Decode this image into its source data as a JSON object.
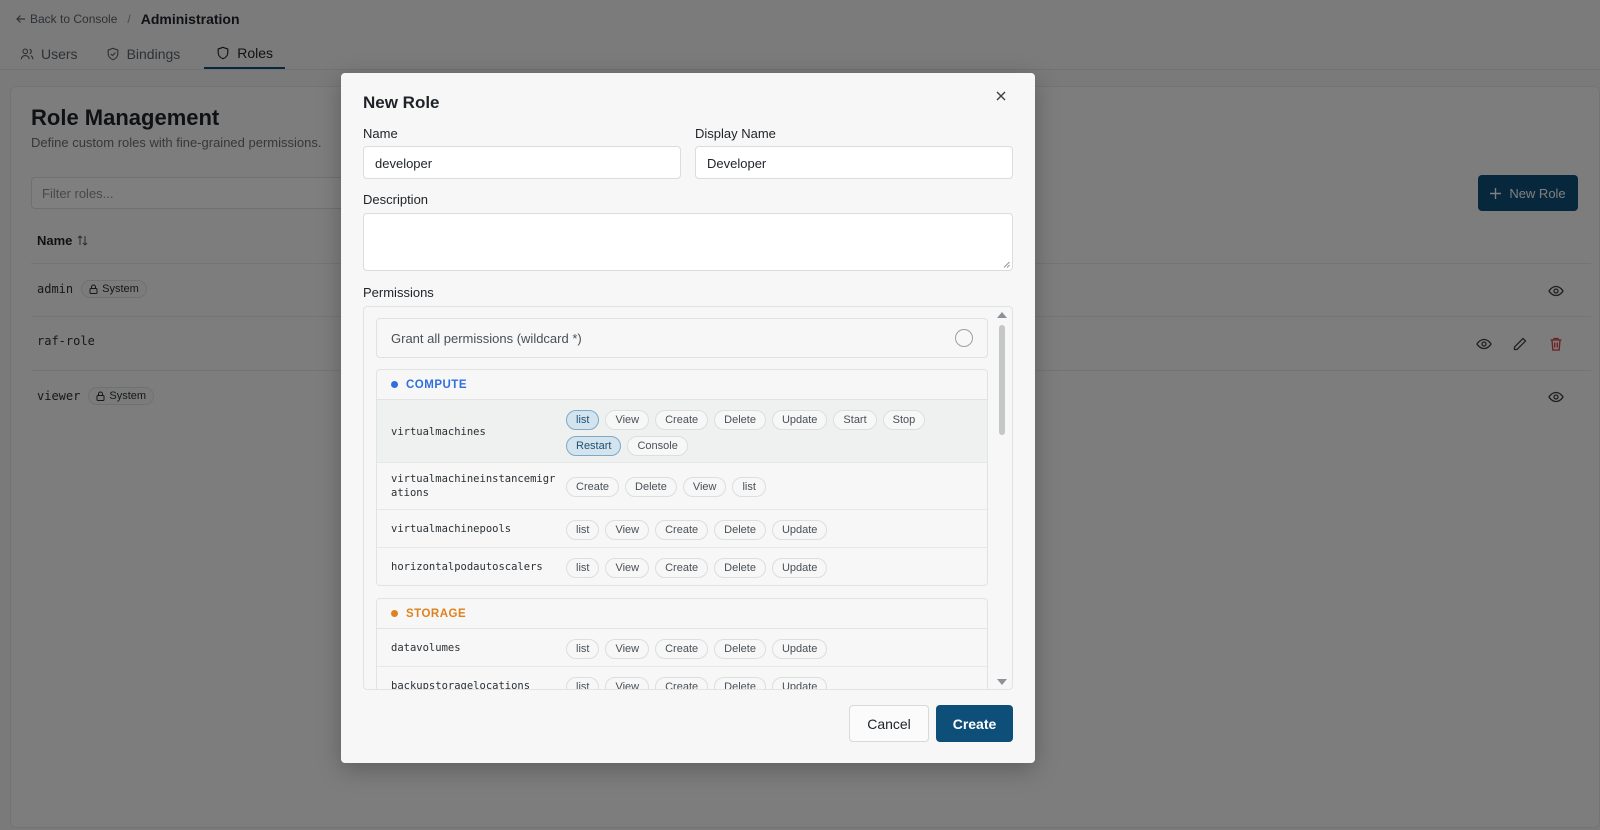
{
  "breadcrumb": {
    "back_label": "Back to Console",
    "separator": "/",
    "current": "Administration"
  },
  "tabs": [
    {
      "label": "Users",
      "icon": "users-icon"
    },
    {
      "label": "Bindings",
      "icon": "shield-icon"
    },
    {
      "label": "Roles",
      "icon": "shield-icon",
      "active": true
    }
  ],
  "page": {
    "title": "Role Management",
    "subtitle": "Define custom roles with fine-grained permissions.",
    "filter_placeholder": "Filter roles...",
    "new_role_label": "New Role",
    "column_name": "Name"
  },
  "roles": [
    {
      "name": "admin",
      "badge": "System"
    },
    {
      "name": "raf-role",
      "badge": ""
    },
    {
      "name": "viewer",
      "badge": "System"
    }
  ],
  "modal": {
    "title": "New Role",
    "name_label": "Name",
    "name_value": "developer",
    "display_name_label": "Display Name",
    "display_name_value": "Developer",
    "description_label": "Description",
    "description_value": "",
    "permissions_label": "Permissions",
    "wildcard_label": "Grant all permissions (wildcard *)",
    "cancel_label": "Cancel",
    "create_label": "Create"
  },
  "permission_groups": [
    {
      "name": "COMPUTE",
      "color": "#2f6fe0",
      "resources": [
        {
          "name": "virtualmachines",
          "verbs": [
            {
              "v": "list",
              "on": true
            },
            {
              "v": "View"
            },
            {
              "v": "Create"
            },
            {
              "v": "Delete"
            },
            {
              "v": "Update"
            },
            {
              "v": "Start"
            },
            {
              "v": "Stop"
            },
            {
              "v": "Restart",
              "on": true
            },
            {
              "v": "Console"
            }
          ]
        },
        {
          "name": "virtualmachineinstancemigr\nations",
          "verbs": [
            {
              "v": "Create"
            },
            {
              "v": "Delete"
            },
            {
              "v": "View"
            },
            {
              "v": "list"
            }
          ]
        },
        {
          "name": "virtualmachinepools",
          "verbs": [
            {
              "v": "list"
            },
            {
              "v": "View"
            },
            {
              "v": "Create"
            },
            {
              "v": "Delete"
            },
            {
              "v": "Update"
            }
          ]
        },
        {
          "name": "horizontalpodautoscalers",
          "verbs": [
            {
              "v": "list"
            },
            {
              "v": "View"
            },
            {
              "v": "Create"
            },
            {
              "v": "Delete"
            },
            {
              "v": "Update"
            }
          ]
        }
      ]
    },
    {
      "name": "STORAGE",
      "color": "#e0821c",
      "resources": [
        {
          "name": "datavolumes",
          "verbs": [
            {
              "v": "list"
            },
            {
              "v": "View"
            },
            {
              "v": "Create"
            },
            {
              "v": "Delete"
            },
            {
              "v": "Update"
            }
          ]
        },
        {
          "name": "backupstoragelocations",
          "verbs": [
            {
              "v": "list"
            },
            {
              "v": "View"
            },
            {
              "v": "Create"
            },
            {
              "v": "Delete"
            },
            {
              "v": "Update"
            }
          ]
        }
      ]
    }
  ],
  "colors": {
    "primary": "#0e4f7a",
    "danger": "#d04040",
    "chip_selected_bg": "#d3e4ef"
  }
}
